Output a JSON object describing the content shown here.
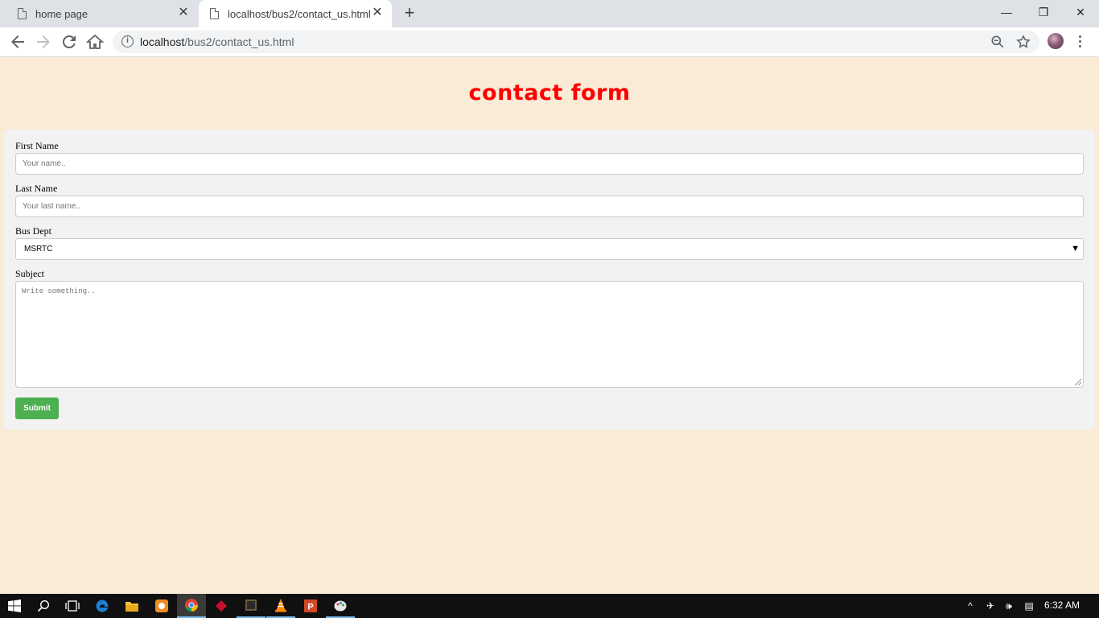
{
  "browser": {
    "tabs": [
      {
        "title": "home page",
        "active": false
      },
      {
        "title": "localhost/bus2/contact_us.html",
        "active": true
      }
    ],
    "new_tab_label": "+",
    "window_controls": {
      "minimize": "—",
      "restore": "❐",
      "close": "✕"
    },
    "url_host": "localhost",
    "url_path": "/bus2/contact_us.html"
  },
  "page": {
    "title": "contact form",
    "form": {
      "first_name_label": "First Name",
      "first_name_placeholder": "Your name..",
      "last_name_label": "Last Name",
      "last_name_placeholder": "Your last name..",
      "bus_dept_label": "Bus Dept",
      "bus_dept_selected": "MSRTC",
      "subject_label": "Subject",
      "subject_placeholder": "Write something..",
      "submit_label": "Submit"
    }
  },
  "taskbar": {
    "clock": "6:32 AM",
    "apps": [
      "start-icon",
      "search-icon",
      "task-view-icon",
      "edge-icon",
      "file-explorer-icon",
      "weather-app-icon",
      "chrome-icon",
      "red-app-icon",
      "terminal-app-icon",
      "vlc-icon",
      "powerpoint-icon",
      "paint-icon"
    ]
  },
  "colors": {
    "page_bg": "#faebd7",
    "title": "#ff0000",
    "submit": "#4caf50",
    "form_bg": "#f2f2f2"
  }
}
